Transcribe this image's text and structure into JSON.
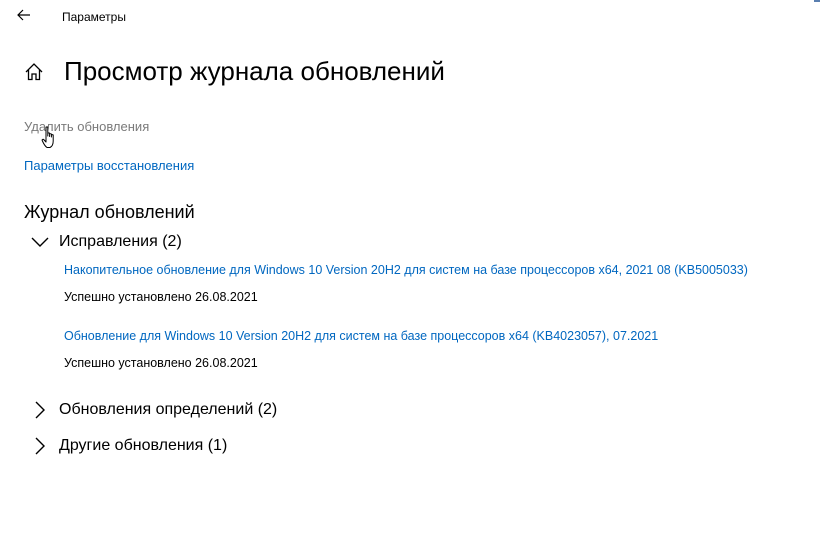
{
  "window": {
    "title": "Параметры"
  },
  "page": {
    "title": "Просмотр журнала обновлений"
  },
  "links": {
    "uninstall_updates": "Удалить обновления",
    "recovery_options": "Параметры восстановления"
  },
  "history": {
    "section_title": "Журнал обновлений",
    "groups": [
      {
        "label": "Исправления (2)",
        "expanded": true,
        "items": [
          {
            "title": "Накопительное обновление для Windows 10 Version 20H2 для систем на базе процессоров x64, 2021 08 (KB5005033)",
            "status": "Успешно установлено 26.08.2021"
          },
          {
            "title": "Обновление для Windows 10 Version 20H2 для систем на базе процессоров x64 (KB4023057), 07.2021",
            "status": "Успешно установлено 26.08.2021"
          }
        ]
      },
      {
        "label": "Обновления определений (2)",
        "expanded": false
      },
      {
        "label": "Другие обновления (1)",
        "expanded": false
      }
    ]
  },
  "icons": {
    "back": "back-arrow-icon",
    "home": "home-icon",
    "expanded": "chevron-down-icon",
    "collapsed": "chevron-right-icon",
    "pointer": "hand-cursor-icon"
  },
  "colors": {
    "link": "#0067c0",
    "disabled": "#7a7a7a",
    "text": "#000000",
    "background": "#ffffff"
  }
}
